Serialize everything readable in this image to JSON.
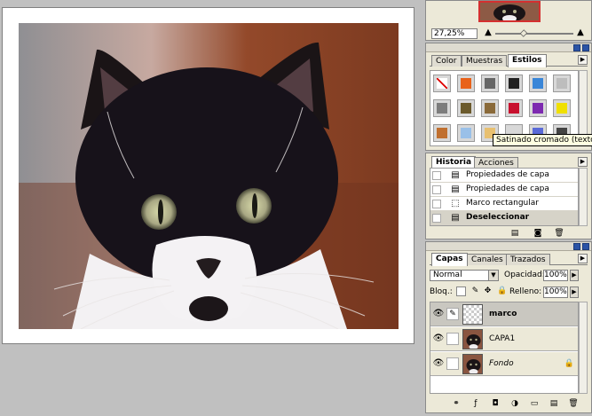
{
  "navigator": {
    "zoom": "27,25%"
  },
  "styles": {
    "tabs": [
      "Color",
      "Muestras",
      "Estilos"
    ],
    "active_tab": "Estilos",
    "tooltip": "Satinado cromado (texto)",
    "swatch_colors": [
      "#ffffff",
      "#e8621a",
      "#666666",
      "#222222",
      "#3a86d8",
      "#bdbdbd",
      "#7d7d7d",
      "#6b5a2c",
      "#8a6a3a",
      "#c8102e",
      "#7d2ab0",
      "#f0e000",
      "#c07030",
      "#9ac0e8",
      "#e8c070",
      "#d8d8d8",
      "#5a6ad8",
      "#444444"
    ]
  },
  "history": {
    "tabs": [
      "Historia",
      "Acciones"
    ],
    "active_tab": "Historia",
    "items": [
      {
        "label": "Propiedades de capa",
        "icon": "doc-icon"
      },
      {
        "label": "Propiedades de capa",
        "icon": "doc-icon"
      },
      {
        "label": "Marco rectangular",
        "icon": "marquee-icon"
      },
      {
        "label": "Deseleccionar",
        "icon": "doc-icon",
        "selected": true
      }
    ]
  },
  "layers": {
    "tabs": [
      "Capas",
      "Canales",
      "Trazados"
    ],
    "active_tab": "Capas",
    "blend_mode": "Normal",
    "opacity_label": "Opacidad:",
    "opacity_value": "100%",
    "lock_label": "Bloq.:",
    "fill_label": "Relleno:",
    "fill_value": "100%",
    "items": [
      {
        "name": "marco",
        "selected": true,
        "italic": false,
        "locked": false,
        "thumb": "checker"
      },
      {
        "name": "CAPA1",
        "selected": false,
        "italic": false,
        "locked": false,
        "thumb": "cat"
      },
      {
        "name": "Fondo",
        "selected": false,
        "italic": true,
        "locked": true,
        "thumb": "cat"
      }
    ]
  }
}
